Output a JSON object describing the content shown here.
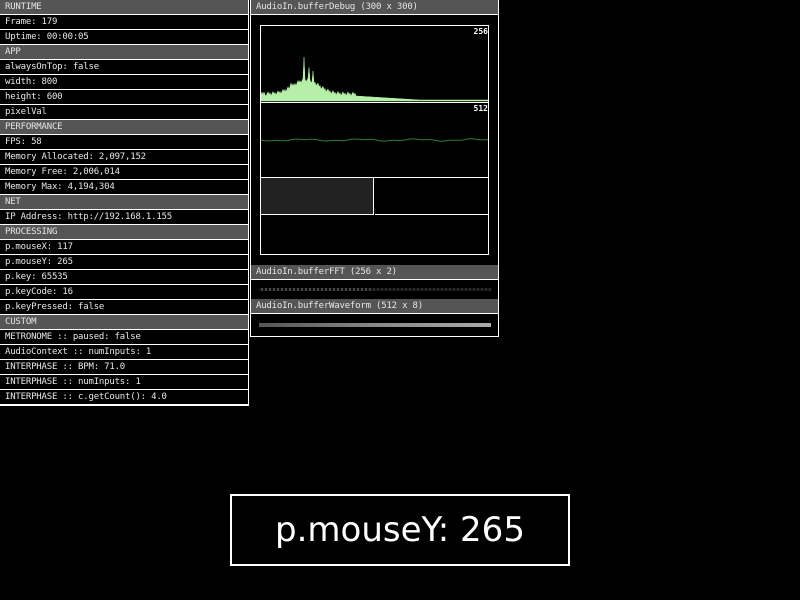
{
  "left_panel": {
    "rows": [
      {
        "type": "header",
        "text": "RUNTIME"
      },
      {
        "type": "item",
        "text": "Frame: 179"
      },
      {
        "type": "item",
        "text": "Uptime: 00:00:05"
      },
      {
        "type": "header",
        "text": "APP"
      },
      {
        "type": "item",
        "text": "alwaysOnTop: false"
      },
      {
        "type": "item",
        "text": "width: 800"
      },
      {
        "type": "item",
        "text": "height: 600"
      },
      {
        "type": "item",
        "text": "pixelVal"
      },
      {
        "type": "header",
        "text": "PERFORMANCE"
      },
      {
        "type": "item",
        "text": "FPS: 58"
      },
      {
        "type": "item",
        "text": "Memory Allocated: 2,097,152"
      },
      {
        "type": "item",
        "text": "Memory Free: 2,006,014"
      },
      {
        "type": "item",
        "text": "Memory Max: 4,194,304"
      },
      {
        "type": "header",
        "text": "NET"
      },
      {
        "type": "item",
        "text": "IP Address: http://192.168.1.155"
      },
      {
        "type": "header",
        "text": "PROCESSING"
      },
      {
        "type": "item",
        "text": "p.mouseX: 117"
      },
      {
        "type": "item",
        "text": "p.mouseY: 265"
      },
      {
        "type": "item",
        "text": "p.key: 65535"
      },
      {
        "type": "item",
        "text": "p.keyCode: 16"
      },
      {
        "type": "item",
        "text": "p.keyPressed: false"
      },
      {
        "type": "header",
        "text": "CUSTOM"
      },
      {
        "type": "item",
        "text": "METRONOME :: paused: false"
      },
      {
        "type": "item",
        "text": "AudioContext :: numInputs: 1"
      },
      {
        "type": "item",
        "text": "INTERPHASE :: BPM: 71.0"
      },
      {
        "type": "item",
        "text": "INTERPHASE :: numInputs: 1"
      },
      {
        "type": "item",
        "text": "INTERPHASE :: c.getCount(): 4.0"
      }
    ]
  },
  "right_panel": {
    "debug_title": "AudioIn.bufferDebug (300 x 300)",
    "fft_tag": "256",
    "wave_tag": "512",
    "fft_title": "AudioIn.bufferFFT (256 x 2)",
    "waveform_title": "AudioIn.bufferWaveform (512 x 8)",
    "colors": {
      "spectrum": "#b6f0a8",
      "wave": "#2e7d32"
    }
  },
  "overlay": {
    "text": "p.mouseY: 265"
  }
}
